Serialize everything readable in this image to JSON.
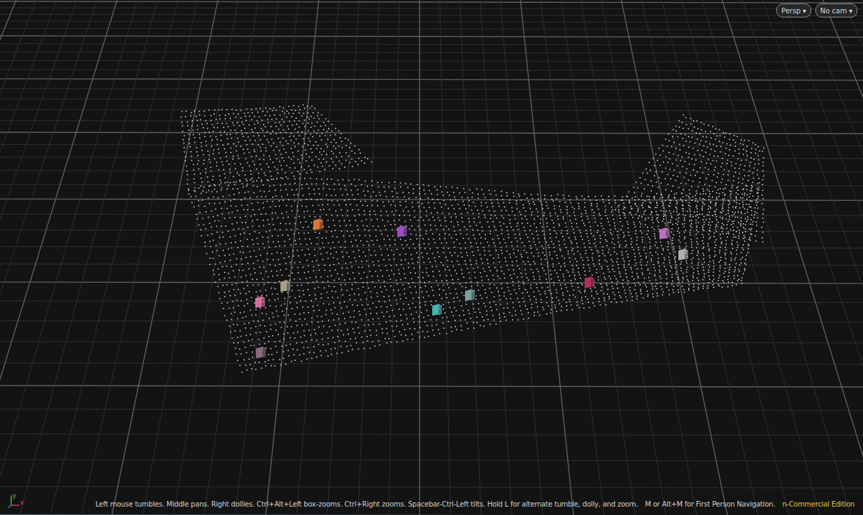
{
  "viewport": {
    "camera_menus": [
      {
        "label": "Persp",
        "arrow": "▾"
      },
      {
        "label": "No cam",
        "arrow": "▾"
      }
    ],
    "axes": [
      {
        "label": "y",
        "color": "#5fd35f"
      },
      {
        "label": "x",
        "color": "#e05050"
      }
    ]
  },
  "objects": [
    {
      "color": "#d9773a"
    },
    {
      "color": "#9b4fc0"
    },
    {
      "color": "#c070c0"
    },
    {
      "color": "#b0b0b0"
    },
    {
      "color": "#b0305a"
    },
    {
      "color": "#7fa0a0"
    },
    {
      "color": "#4fb0b0"
    },
    {
      "color": "#a8a080"
    },
    {
      "color": "#d070a0"
    },
    {
      "color": "#8a6a80"
    }
  ],
  "status_bar": {
    "hints": [
      "Left mouse tumbles. Middle pans. Right dollies. Ctrl+Alt+Left box-zooms. Ctrl+Right zooms. Spacebar-Ctrl-Left tilts. Hold L for alternate tumble, dolly, and zoom.",
      "M or Alt+M for First Person Navigation."
    ],
    "license": "n-Commercial Edition"
  }
}
